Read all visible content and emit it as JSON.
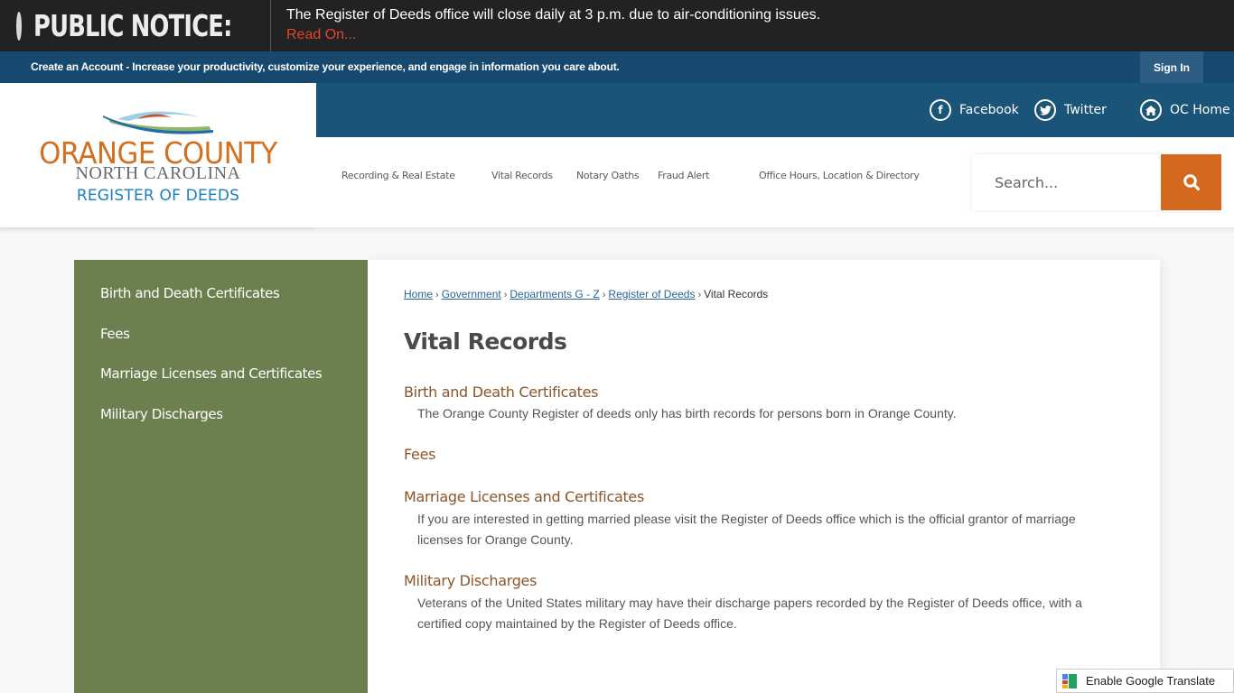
{
  "notice": {
    "title": "PUBLIC NOTICE:",
    "message": "The Register of Deeds office will close daily at 3 p.m. due to air-conditioning issues.",
    "link": "Read On..."
  },
  "account_bar": {
    "text": "Create an Account - Increase your productivity, customize your experience, and engage in information you care about.",
    "sign_in": "Sign In"
  },
  "logo": {
    "line1": "ORANGE COUNTY",
    "line2": "NORTH CAROLINA",
    "line3": "REGISTER OF DEEDS"
  },
  "social": [
    {
      "label": "Facebook",
      "icon": "facebook-icon",
      "glyph": "f"
    },
    {
      "label": "Twitter",
      "icon": "twitter-icon",
      "glyph": "t"
    },
    {
      "label": "OC Home",
      "icon": "home-icon",
      "glyph": "⌂"
    }
  ],
  "nav": [
    {
      "label": "Recording & Real Estate"
    },
    {
      "label": "Vital Records"
    },
    {
      "label": "Notary Oaths"
    },
    {
      "label": "Fraud Alert"
    },
    {
      "label": "Office Hours, Location & Directory"
    }
  ],
  "search": {
    "placeholder": "Search...",
    "value": ""
  },
  "sidebar": {
    "items": [
      {
        "label": "Birth and Death Certificates"
      },
      {
        "label": "Fees"
      },
      {
        "label": "Marriage Licenses and Certificates"
      },
      {
        "label": "Military Discharges"
      }
    ]
  },
  "breadcrumb": {
    "links": [
      "Home",
      "Government",
      "Departments G - Z",
      "Register of Deeds"
    ],
    "current": "Vital Records",
    "separator": "›"
  },
  "page_title": "Vital Records",
  "sections": [
    {
      "heading": "Birth and Death Certificates",
      "body": "The Orange County Register of deeds only has birth records for persons born in Orange County."
    },
    {
      "heading": "Fees",
      "body": ""
    },
    {
      "heading": "Marriage Licenses and Certificates",
      "body": "If you are interested in getting married please visit the Register of Deeds office which is the official grantor of marriage licenses for Orange County."
    },
    {
      "heading": "Military Discharges",
      "body": "Veterans of the United States military may have their discharge papers recorded by the Register of Deeds office, with a certified copy maintained by the Register of Deeds office."
    }
  ],
  "translate": {
    "label": "Enable Google Translate"
  },
  "colors": {
    "notice_bg": "#222222",
    "notice_link": "#e0452e",
    "account_bar": "#17496e",
    "social_bar": "#1a5478",
    "accent_orange": "#d2691e",
    "sidebar_green": "#6b7f4f",
    "section_heading": "#8b5529",
    "logo_blue": "#1a7fc0"
  }
}
